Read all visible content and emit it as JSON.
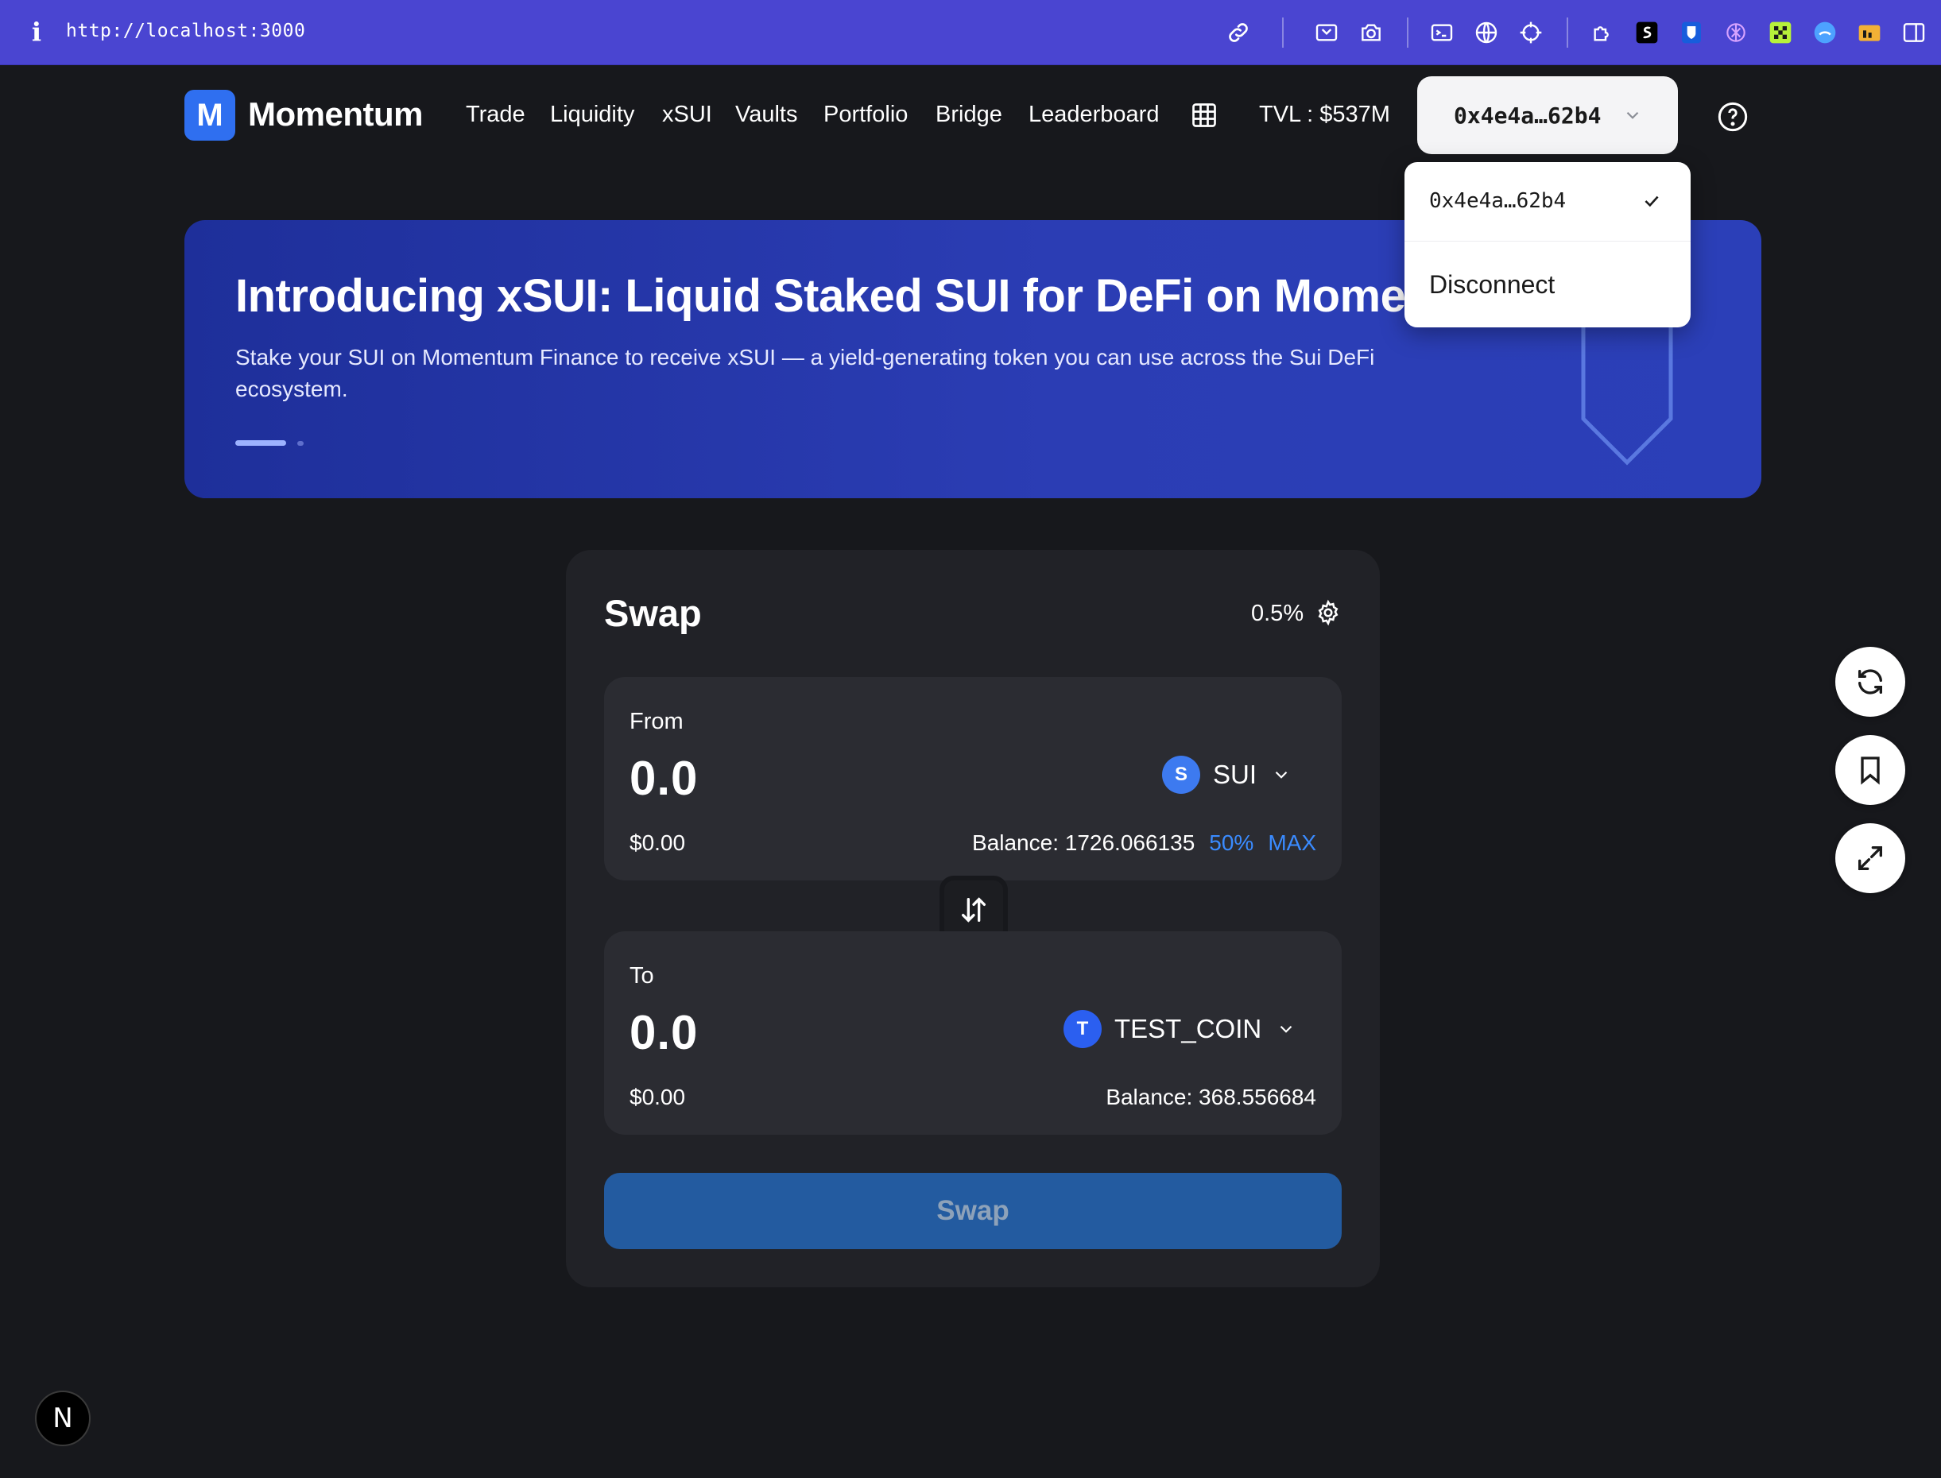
{
  "browser": {
    "url": "http://localhost:3000",
    "info_glyph": "i",
    "toolbar_icons": [
      "link-icon",
      "screenshot-icon",
      "camera-icon",
      "terminal-icon",
      "globe-icon",
      "crosshair-icon",
      "extension-puzzle-icon",
      "extension-s-icon",
      "extension-bitwarden-icon",
      "extension-openai-icon",
      "extension-qr-icon",
      "extension-sui-icon",
      "extension-folder-icon",
      "sidebar-icon"
    ]
  },
  "nav": {
    "logo_letter": "M",
    "brand": "Momentum",
    "links": [
      "Trade",
      "Liquidity",
      "xSUI",
      "Vaults",
      "Portfolio",
      "Bridge",
      "Leaderboard"
    ],
    "tvl": "TVL : $537M",
    "wallet_address": "0x4e4a…62b4"
  },
  "wallet_menu": {
    "address": "0x4e4a…62b4",
    "disconnect": "Disconnect"
  },
  "banner": {
    "title": "Introducing xSUI: Liquid Staked SUI for DeFi on Mome",
    "subtitle": "Stake your SUI on Momentum Finance to receive xSUI — a yield-generating token you can use across the Sui DeFi ecosystem.",
    "slides": 2,
    "active_slide": 1
  },
  "swap": {
    "title": "Swap",
    "slippage": "0.5%",
    "from": {
      "label": "From",
      "amount": "0.0",
      "usd": "$0.00",
      "token_letter": "S",
      "token": "SUI",
      "balance": "Balance: 1726.066135",
      "pct_label": "50%",
      "max_label": "MAX"
    },
    "to": {
      "label": "To",
      "amount": "0.0",
      "usd": "$0.00",
      "token_letter": "T",
      "token": "TEST_COIN",
      "balance": "Balance: 368.556684"
    },
    "submit_label": "Swap"
  },
  "floating": [
    "refresh-icon",
    "bookmark-icon",
    "expand-icon"
  ],
  "dev_badge": "N",
  "colors": {
    "page_bg": "#17181c",
    "browser_bar": "#4a45d1",
    "accent_blue": "#3a8bff",
    "swap_button": "#235ba0"
  }
}
